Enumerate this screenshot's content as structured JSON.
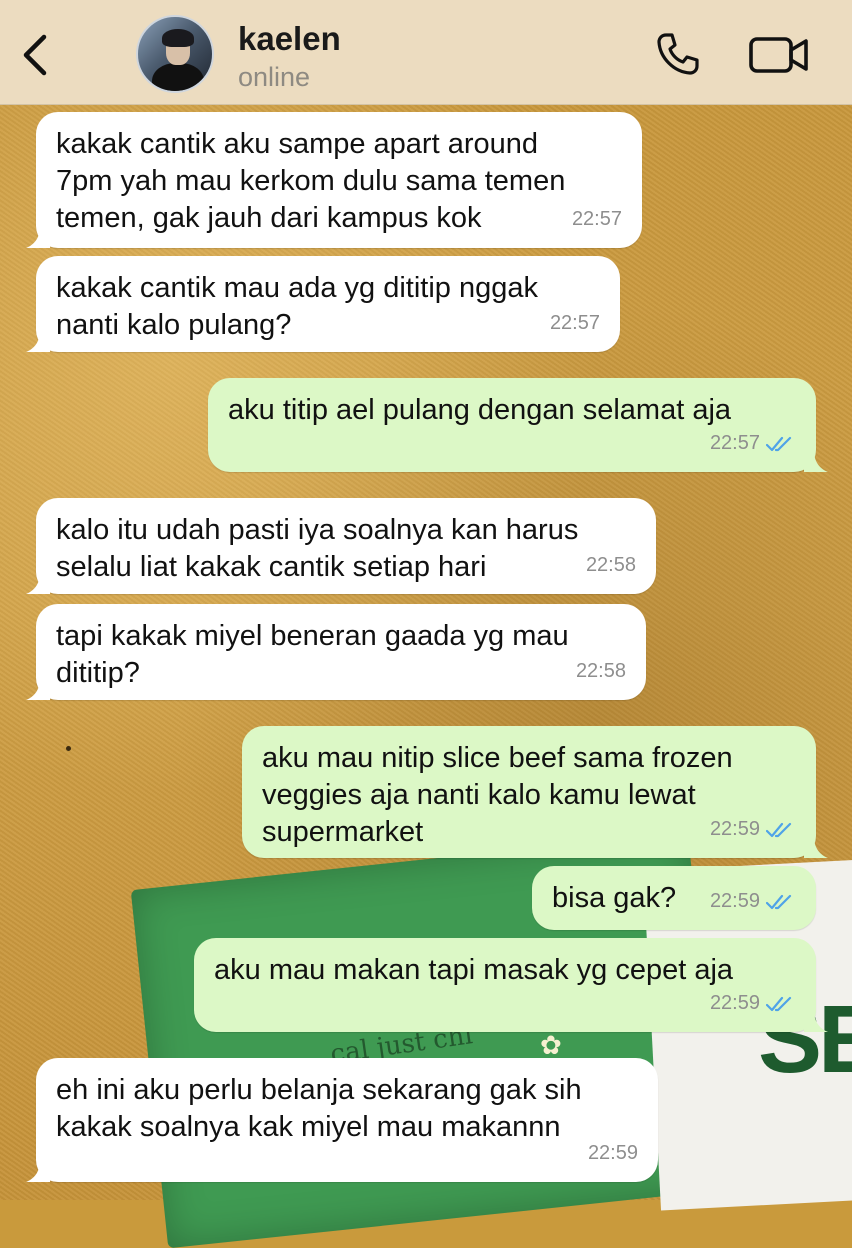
{
  "header": {
    "contact_name": "kaelen",
    "status": "online",
    "icons": [
      "back-chevron-icon",
      "phone-icon",
      "video-camera-icon"
    ]
  },
  "messages": [
    {
      "direction": "in",
      "text": "kakak cantik aku sampe apart around\n7pm yah mau kerkom dulu sama temen\ntemen, gak jauh dari kampus kok",
      "time": "22:57"
    },
    {
      "direction": "in",
      "text": "kakak cantik mau ada yg dititip nggak\nnanti kalo pulang?",
      "time": "22:57"
    },
    {
      "direction": "out",
      "text": "aku titip ael pulang dengan selamat aja",
      "time": "22:57",
      "read": true
    },
    {
      "direction": "in",
      "text": "kalo itu udah pasti iya soalnya kan harus\nselalu liat kakak cantik setiap hari",
      "time": "22:58"
    },
    {
      "direction": "in",
      "text": "tapi kakak miyel beneran gaada yg mau\ndititip?",
      "time": "22:58"
    },
    {
      "direction": "out",
      "text": "aku mau nitip slice beef sama frozen\nveggies aja nanti kalo kamu lewat\nsupermarket",
      "time": "22:59",
      "read": true
    },
    {
      "direction": "out",
      "text": "bisa gak?",
      "time": "22:59",
      "read": true
    },
    {
      "direction": "out",
      "text": "aku mau makan tapi masak yg cepet aja",
      "time": "22:59",
      "read": true
    },
    {
      "direction": "in",
      "text": "eh ini aku perlu belanja sekarang gak sih\nkakak soalnya kak miyel mau makannn",
      "time": "22:59"
    }
  ],
  "wallpaper": {
    "bag_text": "cal  just chi",
    "card_text": "SE"
  },
  "colors": {
    "header_bg": "#ecdcc0",
    "incoming_bubble": "#ffffff",
    "outgoing_bubble": "#dcf8c6",
    "read_ticks": "#4fa3e8",
    "timestamp": "#8e8e8e"
  }
}
